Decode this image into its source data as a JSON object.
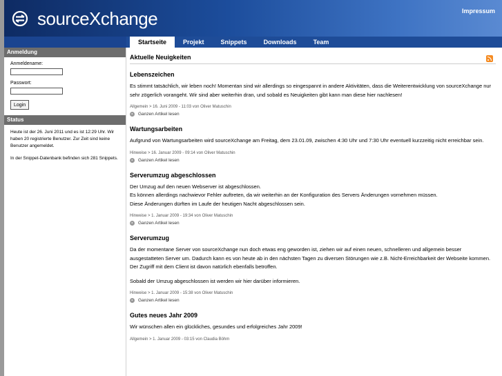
{
  "header": {
    "brand": "sourceXchange",
    "impressum": "Impressum"
  },
  "nav": {
    "tabs": [
      "Startseite",
      "Projekt",
      "Snippets",
      "Downloads",
      "Team"
    ],
    "active": "Startseite"
  },
  "sidebar": {
    "login": {
      "title": "Anmeldung",
      "username_label": "Anmeldename:",
      "password_label": "Passwort:",
      "button": "Login"
    },
    "status": {
      "title": "Status",
      "text1": "Heute ist der 26. Juni 2011 und es ist 12:29 Uhr. Wir haben 20 registrierte Benutzer. Zur Zeit sind keine Benutzer angemeldet.",
      "text2": "In der Snippet-Datenbank befinden sich 281 Snippets."
    }
  },
  "main": {
    "title": "Aktuelle Neuigkeiten",
    "read_more": "Ganzen Artikel lesen",
    "articles": [
      {
        "title": "Lebenszeichen",
        "body": [
          "Es stimmt tatsächlich, wir leben noch! Momentan sind wir allerdings so eingespannt in andere Aktivitäten, dass die Weiterentwicklung von sourceXchange nur sehr zögerlich vorangeht. Wir sind aber weiterhin dran, und sobald es Neuigkeiten gibt kann man diese hier nachlesen!"
        ],
        "meta": "Allgemein > 16. Juni 2009 - 11:03 von Oliver Matuschin"
      },
      {
        "title": "Wartungsarbeiten",
        "body": [
          "Aufgrund von Wartungsarbeiten wird sourceXchange am Freitag, dem 23.01.09, zwischen 4:30 Uhr und 7:30 Uhr eventuell kurzzeitig nicht erreichbar sein."
        ],
        "meta": "Hinweise > 16. Januar 2009 - 09:14 von Oliver Matuschin"
      },
      {
        "title": "Serverumzug abgeschlossen",
        "body": [
          "Der Umzug auf den neuen Webserver ist abgeschlossen.\nEs können allerdings nachwievor Fehler auftreten, da wir weiterhin an der Konfiguration des Servers Änderungen vornehmen müssen.\nDiese Änderungen dürften im Laufe der heutigen Nacht abgeschlossen sein."
        ],
        "meta": "Hinweise > 1. Januar 2009 - 19:34 von Oliver Matuschin"
      },
      {
        "title": "Serverumzug",
        "body": [
          "Da der momentane Server von sourceXchange nun doch etwas eng geworden ist, ziehen wir auf einen neuen, schnelleren und allgemein besser ausgestatteten Server um. Dadurch kann es von heute ab in den nächsten Tagen zu diversen Störungen wie z.B. Nicht-Erreichbarkeit der Webseite kommen. Der Zugriff mit dem Client ist davon natürlich ebenfalls betroffen.",
          "Sobald der Umzug abgeschlossen ist werden wir hier darüber informieren."
        ],
        "meta": "Hinweise > 1. Januar 2009 - 15:38 von Oliver Matuschin"
      },
      {
        "title": "Gutes neues Jahr 2009",
        "body": [
          "Wir wünschen allen ein glückliches, gesundes und erfolgreiches Jahr 2009!"
        ],
        "meta": "Allgemein > 1. Januar 2009 - 03:15 von Claudia Böhm"
      }
    ]
  }
}
